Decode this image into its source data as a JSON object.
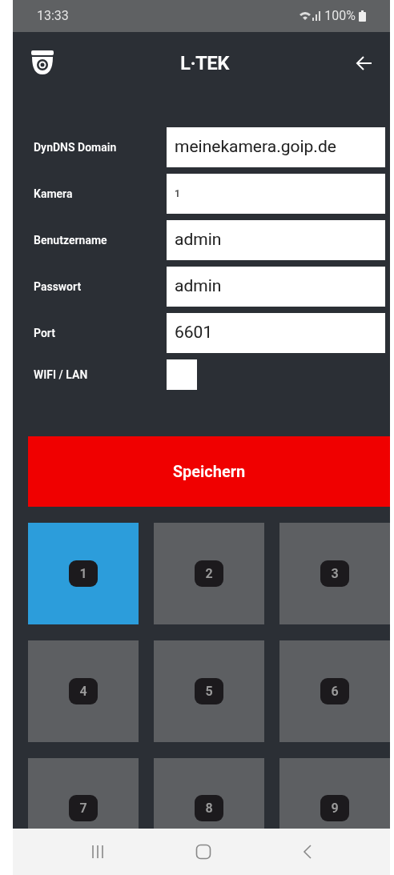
{
  "status_bar": {
    "time": "13:33",
    "battery": "100%"
  },
  "header": {
    "logo": "L·TEK"
  },
  "form": {
    "fields": [
      {
        "kind": "text",
        "label": "DynDNS Domain",
        "value": "meinekamera.goip.de"
      },
      {
        "kind": "number",
        "label": "Kamera",
        "value": "1"
      },
      {
        "kind": "text",
        "label": "Benutzername",
        "value": "admin"
      },
      {
        "kind": "text",
        "label": "Passwort",
        "value": "admin"
      },
      {
        "kind": "text",
        "label": "Port",
        "value": "6601"
      },
      {
        "kind": "checkbox",
        "label": "WIFI / LAN",
        "checked": false
      }
    ]
  },
  "save_button": "Speichern",
  "cameras": [
    {
      "label": "1",
      "selected": true
    },
    {
      "label": "2",
      "selected": false
    },
    {
      "label": "3",
      "selected": false
    },
    {
      "label": "4",
      "selected": false
    },
    {
      "label": "5",
      "selected": false
    },
    {
      "label": "6",
      "selected": false
    },
    {
      "label": "7",
      "selected": false
    },
    {
      "label": "8",
      "selected": false
    },
    {
      "label": "9",
      "selected": false
    }
  ]
}
